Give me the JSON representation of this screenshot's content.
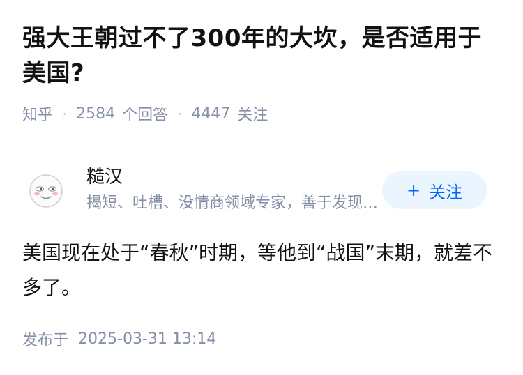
{
  "question": {
    "title": "强大王朝过不了300年的大坎，是否适用于美国?",
    "source": "知乎",
    "answer_count": "2584",
    "answer_unit": "个回答",
    "follower_count": "4447",
    "follower_unit": "关注"
  },
  "author": {
    "name": "糙汉",
    "bio": "揭短、吐槽、没情商领域专家，善于发现别人的缺点",
    "follow_label": "关注",
    "follow_icon": "plus-icon"
  },
  "answer": {
    "text": "美国现在处于“春秋”时期，等他到“战国”末期，就差不多了。"
  },
  "footer": {
    "published_label": "发布于",
    "published_time": "2025-03-31 13:14"
  },
  "colors": {
    "accent": "#0066ff",
    "accent_bg": "#ebf5ff",
    "muted": "#8590a6",
    "text": "#121212"
  }
}
